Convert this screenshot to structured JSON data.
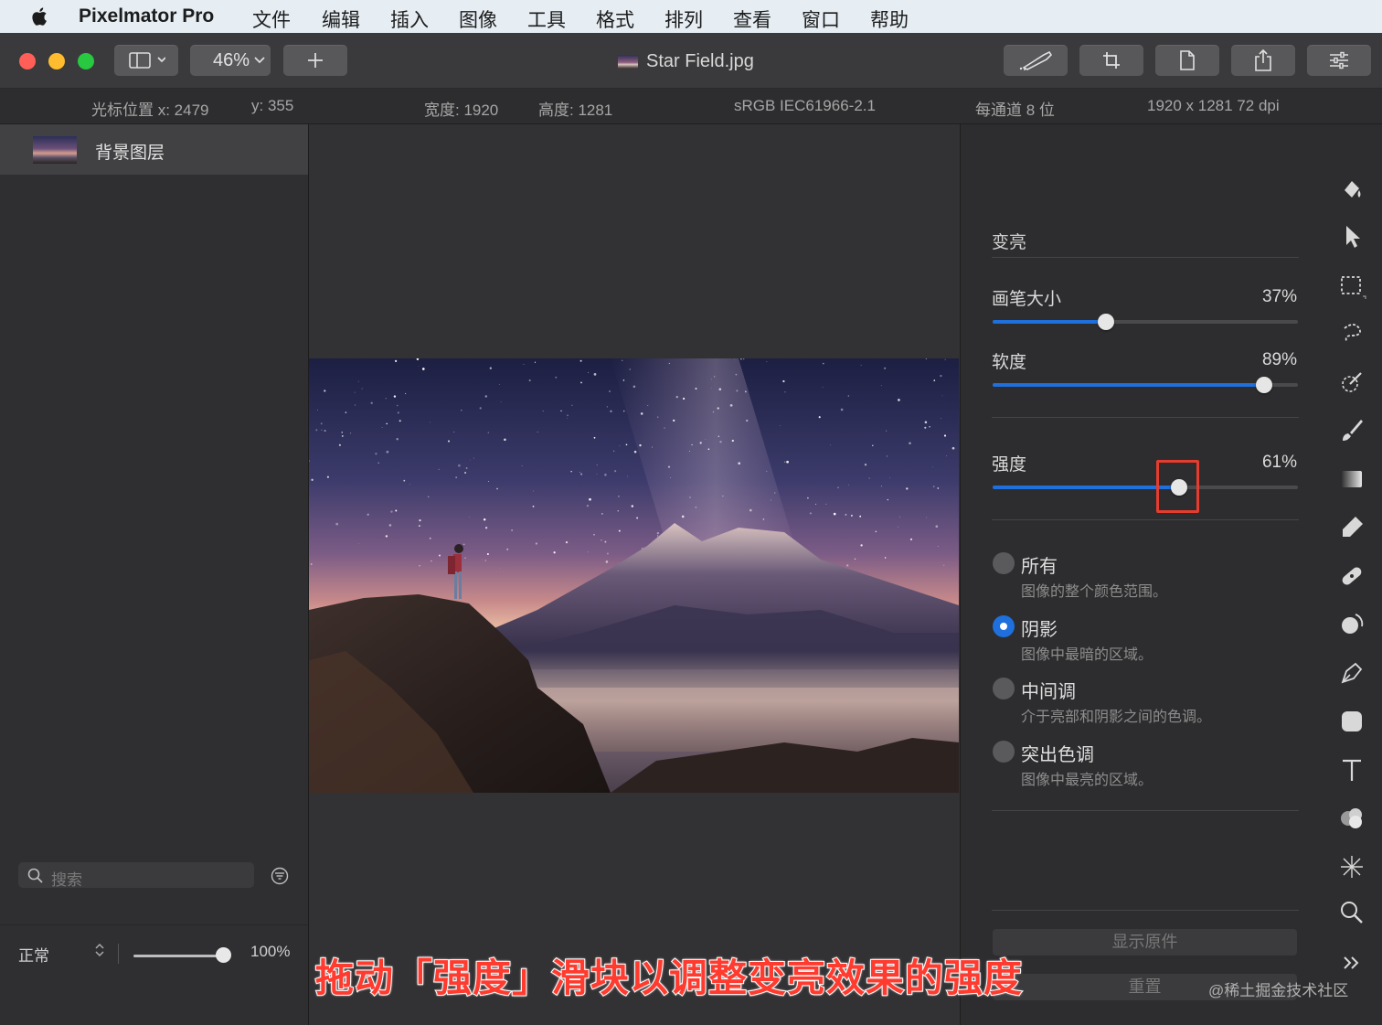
{
  "menubar": {
    "app_name": "Pixelmator Pro",
    "items": [
      "文件",
      "编辑",
      "插入",
      "图像",
      "工具",
      "格式",
      "排列",
      "查看",
      "窗口",
      "帮助"
    ]
  },
  "toolbar": {
    "zoom": "46%",
    "document_title": "Star Field.jpg",
    "traffic_colors": {
      "close": "#ff5f57",
      "minimize": "#febc2e",
      "zoom": "#28c840"
    }
  },
  "infobar": {
    "cursor_x": "光标位置 x:  2479",
    "cursor_y": "y:  355",
    "width": "宽度:  1920",
    "height": "高度:  1281",
    "color_profile": "sRGB IEC61966-2.1",
    "bit_depth": "每通道 8 位",
    "dimensions": "1920 x 1281 72 dpi"
  },
  "layers": {
    "items": [
      {
        "name": "背景图层"
      }
    ],
    "blend_mode": "正常",
    "opacity": "100%",
    "search_placeholder": "搜索"
  },
  "tool_options": {
    "tool_name": "变亮",
    "brush_size": {
      "label": "画笔大小",
      "value": "37%",
      "level": 0.37
    },
    "softness": {
      "label": "软度",
      "value": "89%",
      "level": 0.89
    },
    "strength": {
      "label": "强度",
      "value": "61%",
      "level": 0.61
    },
    "ranges": [
      {
        "title": "所有",
        "desc": "图像的整个颜色范围。",
        "selected": false
      },
      {
        "title": "阴影",
        "desc": "图像中最暗的区域。",
        "selected": true
      },
      {
        "title": "中间调",
        "desc": "介于亮部和阴影之间的色调。",
        "selected": false
      },
      {
        "title": "突出色调",
        "desc": "图像中最亮的区域。",
        "selected": false
      }
    ],
    "show_original": "显示原件",
    "reset": "重置"
  },
  "tools": [
    "fill-icon",
    "arrow-icon",
    "rect-select-icon",
    "lasso-icon",
    "magic-wand-icon",
    "paintbrush-icon",
    "gradient-icon",
    "eraser-icon",
    "bandage-icon",
    "clone-icon",
    "pen-icon",
    "shape-icon",
    "text-icon",
    "color-adjust-icon",
    "effects-icon",
    "zoom-icon",
    "more-icon"
  ],
  "annotation": {
    "caption": "拖动「强度」滑块以调整变亮效果的强度",
    "watermark": "@稀土掘金技术社区",
    "accent": "#ff3b2f"
  }
}
